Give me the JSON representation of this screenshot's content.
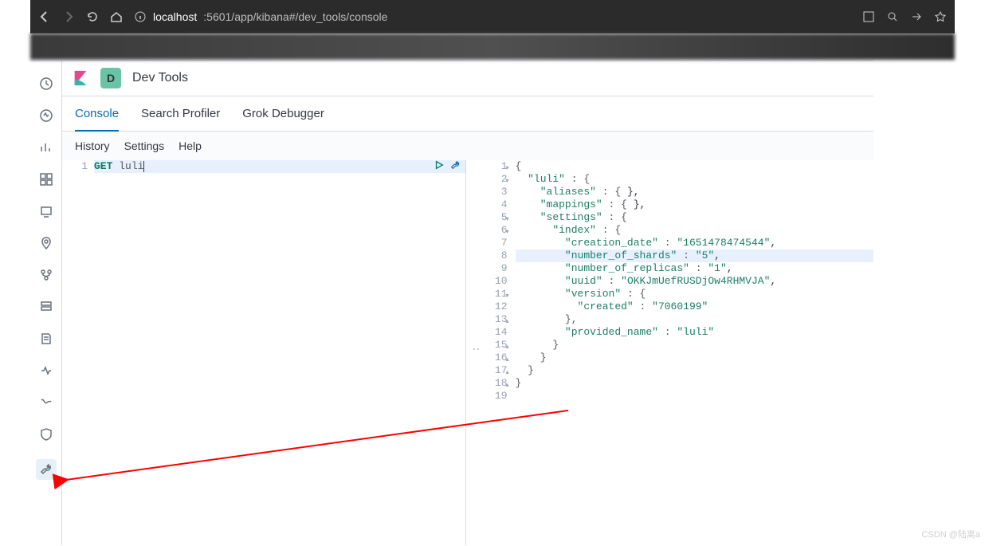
{
  "browser": {
    "url_host": "localhost",
    "url_path": ":5601/app/kibana#/dev_tools/console"
  },
  "header": {
    "badge_letter": "D",
    "title": "Dev Tools"
  },
  "tabs": [
    {
      "label": "Console",
      "active": true
    },
    {
      "label": "Search Profiler",
      "active": false
    },
    {
      "label": "Grok Debugger",
      "active": false
    }
  ],
  "toolbar": {
    "history": "History",
    "settings": "Settings",
    "help": "Help"
  },
  "request": {
    "line_number": "1",
    "method": "GET",
    "endpoint": "luli"
  },
  "response": {
    "lines": [
      {
        "n": "1",
        "fold": true,
        "indent": 0,
        "text": "{"
      },
      {
        "n": "2",
        "fold": true,
        "indent": 1,
        "text": "\"luli\" : {"
      },
      {
        "n": "3",
        "fold": false,
        "indent": 2,
        "text": "\"aliases\" : { },"
      },
      {
        "n": "4",
        "fold": false,
        "indent": 2,
        "text": "\"mappings\" : { },"
      },
      {
        "n": "5",
        "fold": true,
        "indent": 2,
        "text": "\"settings\" : {"
      },
      {
        "n": "6",
        "fold": true,
        "indent": 3,
        "text": "\"index\" : {"
      },
      {
        "n": "7",
        "fold": false,
        "indent": 4,
        "text": "\"creation_date\" : \"1651478474544\","
      },
      {
        "n": "8",
        "fold": false,
        "indent": 4,
        "hl": true,
        "text": "\"number_of_shards\" : \"5\","
      },
      {
        "n": "9",
        "fold": false,
        "indent": 4,
        "text": "\"number_of_replicas\" : \"1\","
      },
      {
        "n": "10",
        "fold": false,
        "indent": 4,
        "text": "\"uuid\" : \"OKKJmUefRUSDjOw4RHMVJA\","
      },
      {
        "n": "11",
        "fold": true,
        "indent": 4,
        "text": "\"version\" : {"
      },
      {
        "n": "12",
        "fold": false,
        "indent": 5,
        "text": "\"created\" : \"7060199\""
      },
      {
        "n": "13",
        "fold": false,
        "indent": 4,
        "close": true,
        "text": "},"
      },
      {
        "n": "14",
        "fold": false,
        "indent": 4,
        "text": "\"provided_name\" : \"luli\""
      },
      {
        "n": "15",
        "fold": false,
        "indent": 3,
        "close": true,
        "text": "}"
      },
      {
        "n": "16",
        "fold": false,
        "indent": 2,
        "close": true,
        "text": "}"
      },
      {
        "n": "17",
        "fold": false,
        "indent": 1,
        "close": true,
        "text": "}"
      },
      {
        "n": "18",
        "fold": false,
        "indent": 0,
        "close": true,
        "text": "}"
      },
      {
        "n": "19",
        "fold": false,
        "indent": 0,
        "text": ""
      }
    ]
  },
  "watermark": "CSDN @陆离a"
}
